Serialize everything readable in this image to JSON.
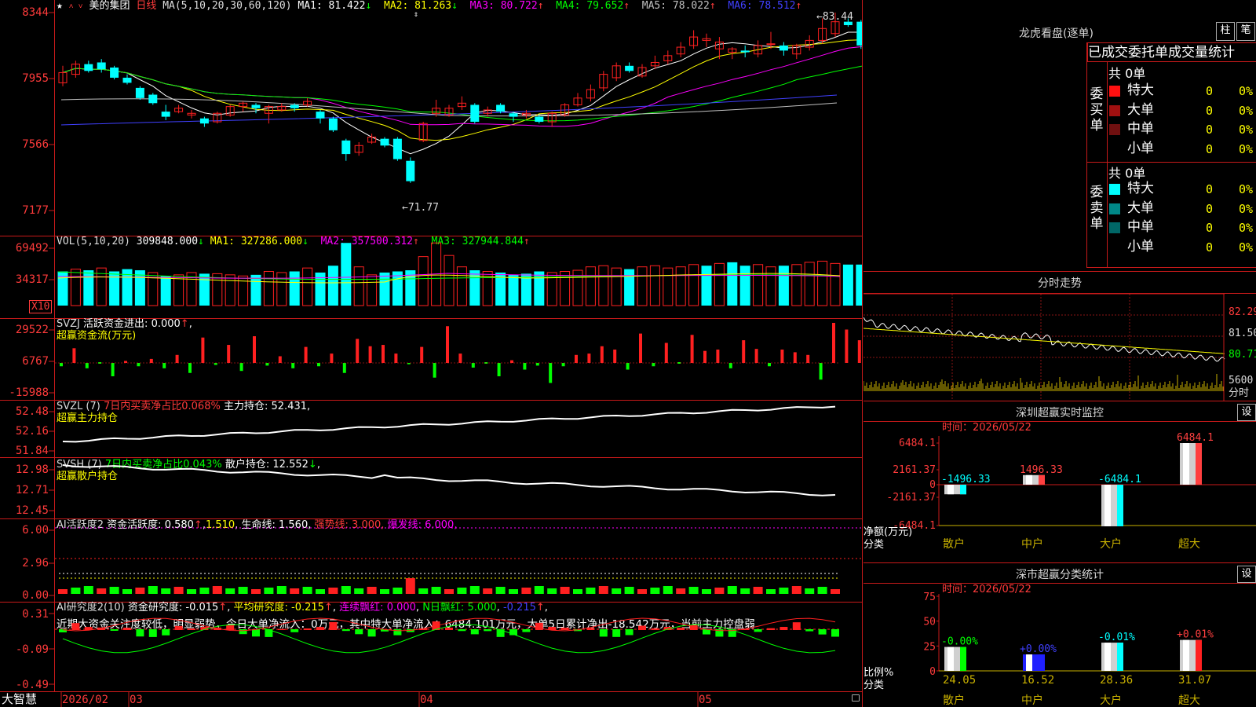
{
  "stock": {
    "name": "美的集团",
    "period": "日线",
    "star": "★",
    "arrows": "˄ ˅"
  },
  "ma_line": {
    "label": "MA(5,10,20,30,60,120)",
    "items": [
      {
        "name": "MA1",
        "value": "81.422",
        "dir": "↓",
        "color": "#ffffff"
      },
      {
        "name": "MA2",
        "value": "81.263",
        "dir": "↓",
        "color": "#ffff00"
      },
      {
        "name": "MA3",
        "value": "80.722",
        "dir": "↑",
        "color": "#ff00ff"
      },
      {
        "name": "MA4",
        "value": "79.652",
        "dir": "↑",
        "color": "#00ff00"
      },
      {
        "name": "MA5",
        "value": "78.022",
        "dir": "↑",
        "color": "#c0c0c0"
      },
      {
        "name": "MA6",
        "value": "78.512",
        "dir": "↑",
        "color": "#4040ff"
      }
    ]
  },
  "price_axis": [
    "8344",
    "7955",
    "7566",
    "7177"
  ],
  "price_annotations": {
    "high": "83.44",
    "low": "71.77"
  },
  "vol": {
    "label": "VOL(5,10,20)",
    "value": "309848.000",
    "dir": "↓",
    "items": [
      {
        "name": "MA1",
        "value": "327286.000",
        "dir": "↓",
        "color": "#ffff00"
      },
      {
        "name": "MA2",
        "value": "357500.312",
        "dir": "↑",
        "color": "#ff00ff"
      },
      {
        "name": "MA3",
        "value": "327944.844",
        "dir": "↑",
        "color": "#00ff00"
      }
    ],
    "axis": [
      "69492",
      "34317"
    ],
    "unit": "X10"
  },
  "svzj": {
    "label": "SVZJ",
    "name": "活跃资金进出",
    "value": "0.000",
    "dir": "↑",
    "sub": "超赢资金流(万元)",
    "axis": [
      "29522",
      "6767",
      "-15988"
    ]
  },
  "svzl": {
    "label": "SVZL (7)",
    "t1": "7日内买卖净占比0.068%",
    "t2": "主力持仓",
    "value": "52.431",
    "sub": "超赢主力持仓",
    "axis": [
      "52.48",
      "52.16",
      "51.84"
    ]
  },
  "svsh": {
    "label": "SVSH (7)",
    "t1": "7日内买卖净占比0.043%",
    "t2": "散户持仓",
    "value": "12.552",
    "dir": "↓",
    "sub": "超赢散户持仓",
    "axis": [
      "12.98",
      "12.71",
      "12.45"
    ]
  },
  "ai1": {
    "label": "AI活跃度2",
    "t1": "资金活跃度",
    "v1": "0.580",
    "d1": "↑",
    "v2": "1.510",
    "t2": "生命线",
    "v3": "1.560",
    "t3": "强势线",
    "v4": "3.000",
    "t4": "爆发线",
    "v5": "6.000",
    "axis": [
      "6.00",
      "2.96",
      "0.00"
    ]
  },
  "ai2": {
    "label": "AI研究度2(10)",
    "t1": "资金研究度",
    "v1": "-0.015",
    "d1": "↑",
    "t2": "平均研究度",
    "v2": "-0.215",
    "d2": "↑",
    "t3": "连续飘红",
    "v3": "0.000",
    "t4": "N日飘红",
    "v4": "5.000",
    "v5": "-0.215",
    "d5": "↑",
    "axis": [
      "0.31",
      "-0.09",
      "-0.49"
    ],
    "comment": "近期大资金关注度较低，明显弱势，今日大单净流入：0万元，其中特大单净流入：6484.101万元，大单5日累计净出-18.542万元，当前主力控盘弱"
  },
  "date_axis": {
    "logo": "大智慧",
    "labels": [
      "2026/02",
      "03",
      "04",
      "05"
    ]
  },
  "dragon": {
    "title": "龙虎看盘(逐单)",
    "btn1": "柱",
    "btn2": "笔",
    "tabs": "已成交委托单成交量统计",
    "buy_label": "委买单",
    "sell_label": "委卖单",
    "buy_total": "共 0单",
    "sell_total": "共 0单",
    "buy_rows": [
      {
        "name": "特大",
        "vol": "0",
        "pct": "0%",
        "color": "#ff1010"
      },
      {
        "name": "大单",
        "vol": "0",
        "pct": "0%",
        "color": "#a01010"
      },
      {
        "name": "中单",
        "vol": "0",
        "pct": "0%",
        "color": "#701010"
      },
      {
        "name": "小单",
        "vol": "0",
        "pct": "0%",
        "color": "#000000"
      }
    ],
    "sell_rows": [
      {
        "name": "特大",
        "vol": "0",
        "pct": "0%",
        "color": "#00ffff"
      },
      {
        "name": "大单",
        "vol": "0",
        "pct": "0%",
        "color": "#008888"
      },
      {
        "name": "中单",
        "vol": "0",
        "pct": "0%",
        "color": "#006666"
      },
      {
        "name": "小单",
        "vol": "0",
        "pct": "0%",
        "color": "#000000"
      }
    ]
  },
  "intraday": {
    "title": "分时走势",
    "axis": [
      "82.29",
      "81.50",
      "80.71"
    ],
    "vol_label": "5600",
    "vol_unit": "分时"
  },
  "monitor": {
    "title": "深圳超赢实时监控",
    "btn": "设",
    "time_label": "时间：2026/05/22",
    "axis": [
      "6484.1",
      "2161.37",
      "0",
      "-2161.37",
      "-6484.1"
    ],
    "ylabel": "净额(万元)",
    "xlabel": "分类",
    "categories": [
      "散户",
      "中户",
      "大户",
      "超大"
    ],
    "values": [
      -1496.33,
      1496.33,
      -6484.1,
      6484.1
    ],
    "value_labels": [
      "-1496.33",
      "1496.33",
      "-6484.1",
      "6484.1"
    ]
  },
  "classify": {
    "title": "深市超赢分类统计",
    "btn": "设",
    "time_label": "时间：2026/05/22",
    "axis": [
      "75",
      "50",
      "25",
      "0"
    ],
    "ylabel": "比例%",
    "xlabel": "分类",
    "categories": [
      "散户",
      "中户",
      "大户",
      "超大"
    ],
    "values": [
      24.05,
      16.52,
      28.36,
      31.07
    ],
    "value_labels": [
      "24.05",
      "16.52",
      "28.36",
      "31.07"
    ],
    "change_labels": [
      "-0.00%",
      "+0.00%",
      "-0.01%",
      "+0.01%"
    ]
  },
  "chart_data": [
    {
      "type": "bar",
      "title": "深圳超赢实时监控",
      "categories": [
        "散户",
        "中户",
        "大户",
        "超大"
      ],
      "values": [
        -1496.33,
        1496.33,
        -6484.1,
        6484.1
      ],
      "ylabel": "净额(万元)",
      "xlabel": "分类",
      "ylim": [
        -6484.1,
        6484.1
      ]
    },
    {
      "type": "bar",
      "title": "深市超赢分类统计",
      "categories": [
        "散户",
        "中户",
        "大户",
        "超大"
      ],
      "values": [
        24.05,
        16.52,
        28.36,
        31.07
      ],
      "ylabel": "比例%",
      "xlabel": "分类",
      "ylim": [
        0,
        75
      ]
    }
  ]
}
